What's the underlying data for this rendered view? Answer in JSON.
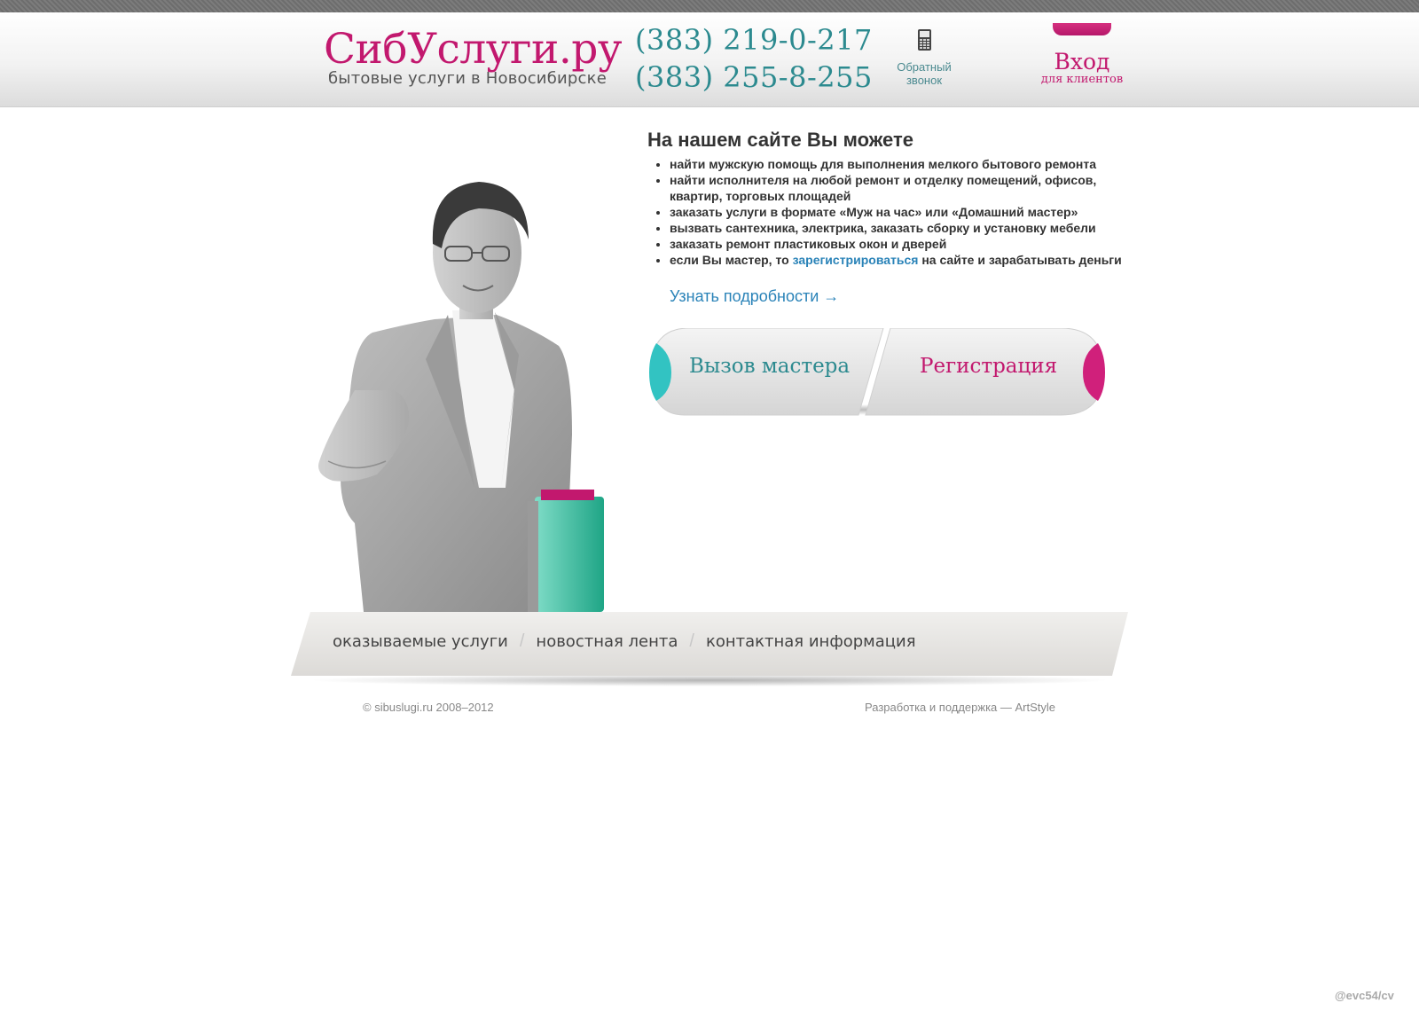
{
  "header": {
    "logo": "СибУслуги.ру",
    "tagline": "бытовые услуги в Новосибирске",
    "phones": [
      "(383) 219-0-217",
      "(383) 255-8-255"
    ],
    "callback": [
      "Обратный",
      "звонок"
    ],
    "login": {
      "title": "Вход",
      "subtitle": "для клиентов"
    }
  },
  "main": {
    "heading": "На нашем сайте Вы можете",
    "items": [
      "найти мужскую помощь для выполнения мелкого бытового ремонта",
      "найти исполнителя на любой ремонт и отделку помещений, офисов, квартир, торговых площадей",
      "заказать услуги в формате «Муж на час» или «Домашний мастер»",
      "вызвать сантехника, электрика, заказать сборку и установку мебели",
      "заказать ремонт пластиковых окон и дверей"
    ],
    "last_item": {
      "before": "если Вы мастер, то",
      "link": "зарегистрироваться",
      "after": "на сайте и зарабатывать деньги"
    },
    "more_link": "Узнать подробности →",
    "buttons": {
      "call": "Вызов мастера",
      "register": "Регистрация"
    }
  },
  "nav": [
    "оказываемые услуги",
    "новостная лента",
    "контактная информация"
  ],
  "footer": {
    "copyright": "© sibuslugi.ru 2008–2012",
    "developer": "Разработка и поддержка — ArtStyle"
  },
  "watermark": "@evc54/cv",
  "colors": {
    "brand": "#c2186e",
    "teal": "#2c8a8f",
    "link": "#2a83b8"
  },
  "icons": [
    "mobile-phone-icon",
    "arrow-right-icon"
  ]
}
